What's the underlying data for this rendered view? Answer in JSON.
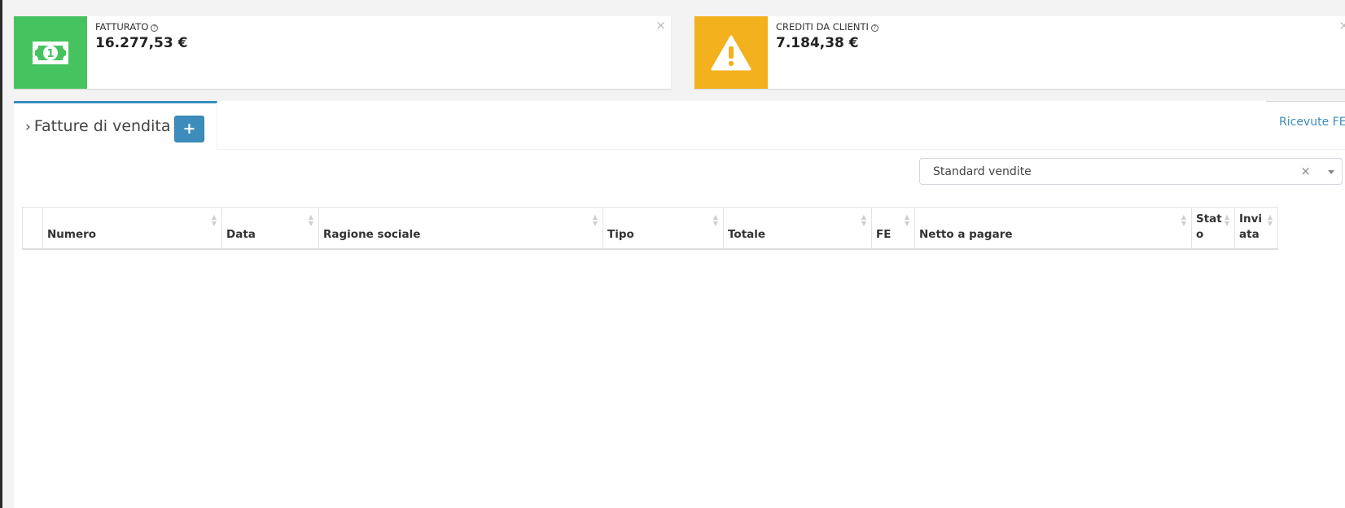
{
  "info_boxes": [
    {
      "label": "FATTURATO",
      "value": "16.277,53 €",
      "color": "#46c35f",
      "icon": "money-bill-icon"
    },
    {
      "label": "CREDITI DA CLIENTI",
      "value": "7.184,38 €",
      "color": "#f3b11e",
      "icon": "warning-icon"
    }
  ],
  "tabs": {
    "active_title": "Fatture di vendita",
    "add_label": "+",
    "right_link": "Ricevute FE"
  },
  "filter": {
    "selected": "Standard vendite",
    "clear": "×"
  },
  "table": {
    "columns": [
      "",
      "Numero",
      "Data",
      "Ragione sociale",
      "Tipo",
      "Totale",
      "FE",
      "Netto a pagare",
      "Stat o",
      "Invi ata"
    ]
  }
}
